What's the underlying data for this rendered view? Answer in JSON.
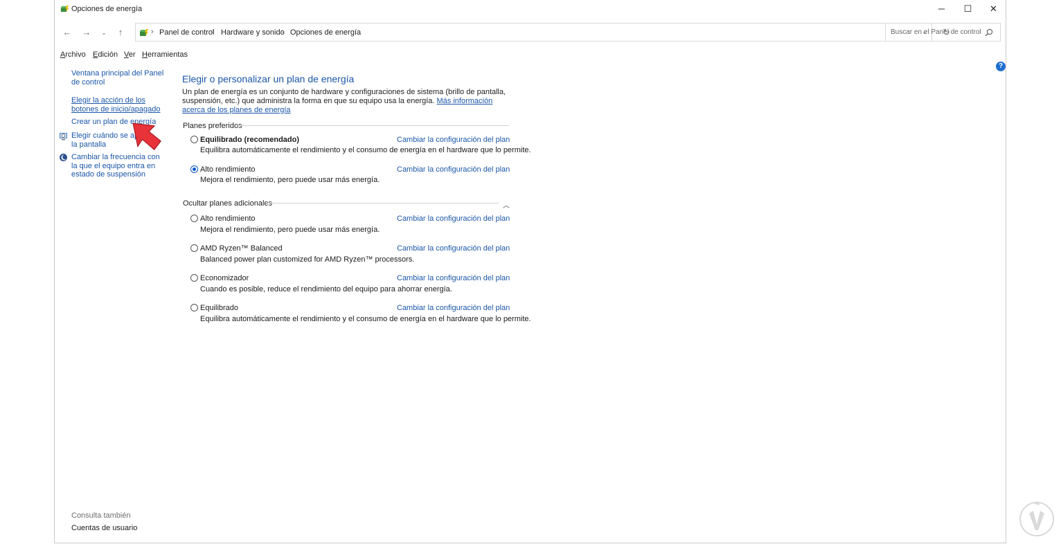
{
  "window": {
    "title": "Opciones de energía",
    "minimize": "─",
    "maximize": "☐",
    "close": "✕"
  },
  "address_bar": {
    "breadcrumbs": [
      "Panel de control",
      "Hardware y sonido",
      "Opciones de energía"
    ],
    "separator": "›",
    "search_placeholder": "Buscar en el Panel de control"
  },
  "menu": {
    "items": [
      {
        "first": "A",
        "rest": "rchivo"
      },
      {
        "first": "E",
        "rest": "dición"
      },
      {
        "first": "V",
        "rest": "er"
      },
      {
        "first": "H",
        "rest": "erramientas"
      }
    ]
  },
  "sidebar": {
    "home_link": "Ventana principal del Panel de control",
    "links": [
      "Elegir la acción de los botones de inicio/apagado",
      "Crear un plan de energía",
      "Elegir cuándo se apaga la pantalla",
      "Cambiar la frecuencia con la que el equipo entra en estado de suspensión"
    ],
    "see_also_title": "Consulta también",
    "see_also_link": "Cuentas de usuario"
  },
  "main": {
    "title": "Elegir o personalizar un plan de energía",
    "intro": "Un plan de energía es un conjunto de hardware y configuraciones de sistema (brillo de pantalla, suspensión, etc.) que administra la forma en que su equipo usa la energía.",
    "intro_link": "Más información acerca de los planes de energía",
    "preferred_heading": "Planes preferidos",
    "additional_heading": "Ocultar planes adicionales",
    "change_link": "Cambiar la configuración del plan",
    "preferred_plans": [
      {
        "name": "Equilibrado (recomendado)",
        "desc": "Equilibra automáticamente el rendimiento y el consumo de energía en el hardware que lo permite.",
        "selected": false
      },
      {
        "name": "Alto rendimiento",
        "desc": "Mejora el rendimiento, pero puede usar más energía.",
        "selected": true
      }
    ],
    "additional_plans": [
      {
        "name": "Alto rendimiento",
        "desc": "Mejora el rendimiento, pero puede usar más energía.",
        "selected": false
      },
      {
        "name": "AMD Ryzen™ Balanced",
        "desc": "Balanced power plan customized for AMD Ryzen™ processors.",
        "selected": false
      },
      {
        "name": "Economizador",
        "desc": "Cuando es posible, reduce el rendimiento del equipo para ahorrar energía.",
        "selected": false
      },
      {
        "name": "Equilibrado",
        "desc": "Equilibra automáticamente el rendimiento y el consumo de energía en el hardware que lo permite.",
        "selected": false
      }
    ]
  },
  "help_label": "?",
  "colors": {
    "link": "#1a56a8",
    "accent": "#0b57c7",
    "annotation_arrow": "#e8333a"
  }
}
